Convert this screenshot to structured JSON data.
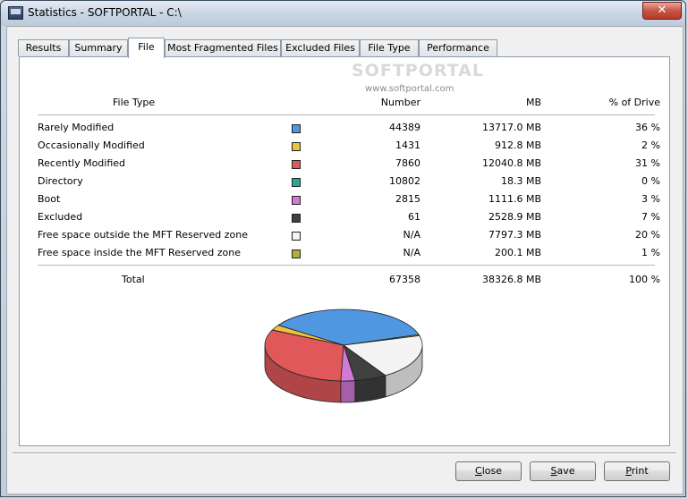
{
  "window": {
    "title": "Statistics - SOFTPORTAL - C:\\",
    "close_glyph": "✕"
  },
  "tabs": [
    {
      "label": "Results"
    },
    {
      "label": "Summary"
    },
    {
      "label": "File",
      "active": true
    },
    {
      "label": "Most Fragmented Files"
    },
    {
      "label": "Excluded Files"
    },
    {
      "label": "File Type"
    },
    {
      "label": "Performance"
    }
  ],
  "watermark": {
    "logo": "SOFTPORTAL",
    "url": "www.softportal.com"
  },
  "table": {
    "headers": {
      "file_type": "File Type",
      "number": "Number",
      "mb": "MB",
      "percent": "% of Drive"
    },
    "rows": [
      {
        "type": "Rarely Modified",
        "color": "#4f97e0",
        "number": "44389",
        "mb": "13717.0 MB",
        "percent": "36 %"
      },
      {
        "type": "Occasionally Modified",
        "color": "#f0c040",
        "number": "1431",
        "mb": "912.8 MB",
        "percent": "2 %"
      },
      {
        "type": "Recently Modified",
        "color": "#e0585a",
        "number": "7860",
        "mb": "12040.8 MB",
        "percent": "31 %"
      },
      {
        "type": "Directory",
        "color": "#28a89a",
        "number": "10802",
        "mb": "18.3 MB",
        "percent": "0 %"
      },
      {
        "type": "Boot",
        "color": "#d27ad8",
        "number": "2815",
        "mb": "1111.6 MB",
        "percent": "3 %"
      },
      {
        "type": "Excluded",
        "color": "#404040",
        "number": "61",
        "mb": "2528.9 MB",
        "percent": "7 %"
      },
      {
        "type": "Free space outside the MFT Reserved zone",
        "color": "#f4f4f4",
        "number": "N/A",
        "mb": "7797.3 MB",
        "percent": "20 %"
      },
      {
        "type": "Free space inside the MFT Reserved zone",
        "color": "#b0b040",
        "number": "N/A",
        "mb": "200.1 MB",
        "percent": "1 %"
      }
    ],
    "total": {
      "label": "Total",
      "number": "67358",
      "mb": "38326.8 MB",
      "percent": "100 %"
    }
  },
  "chart_data": {
    "type": "pie",
    "title": "",
    "slices": [
      {
        "label": "Rarely Modified",
        "value": 13717.0,
        "color": "#4f97e0"
      },
      {
        "label": "Free space inside the MFT Reserved zone",
        "value": 200.1,
        "color": "#b0b040"
      },
      {
        "label": "Free space outside the MFT Reserved zone",
        "value": 7797.3,
        "color": "#f4f4f4"
      },
      {
        "label": "Excluded",
        "value": 2528.9,
        "color": "#404040"
      },
      {
        "label": "Boot",
        "value": 1111.6,
        "color": "#d27ad8"
      },
      {
        "label": "Recently Modified",
        "value": 12040.8,
        "color": "#e0585a"
      },
      {
        "label": "Directory",
        "value": 18.3,
        "color": "#28a89a"
      },
      {
        "label": "Occasionally Modified",
        "value": 912.8,
        "color": "#f0c040"
      }
    ],
    "style": "3d"
  },
  "buttons": {
    "close": {
      "label": "Close",
      "mnemonic": "C"
    },
    "save": {
      "label": "Save",
      "mnemonic": "S"
    },
    "print": {
      "label": "Print",
      "mnemonic": "P"
    }
  }
}
